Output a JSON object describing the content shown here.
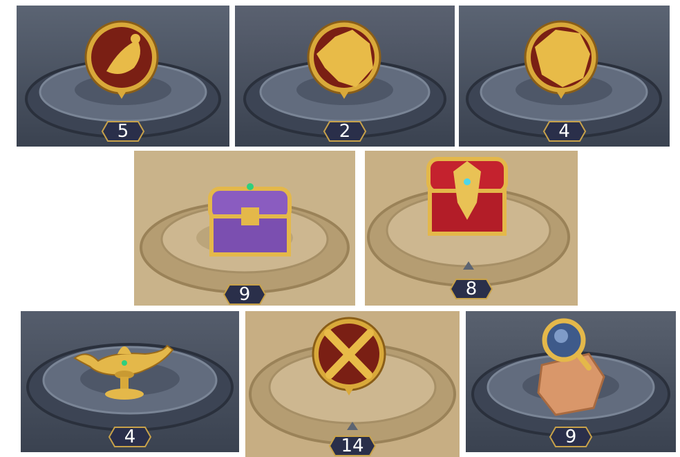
{
  "tiles": [
    {
      "row": 1,
      "kind": "stone",
      "icon": "scorcerer-scorpion-medallion",
      "icon_name": "scorpion-icon",
      "count": "5"
    },
    {
      "row": 1,
      "kind": "stone",
      "icon": "wolf-medallion",
      "icon_name": "wolf-icon",
      "count": "2"
    },
    {
      "row": 1,
      "kind": "stone",
      "icon": "lion-medallion",
      "icon_name": "lion-icon",
      "count": "4"
    },
    {
      "row": 2,
      "kind": "sand",
      "icon": "purple-treasure-chest",
      "icon_name": "purple-chest-icon",
      "count": "9"
    },
    {
      "row": 2,
      "kind": "sand",
      "icon": "red-treasure-chest",
      "icon_name": "red-chest-icon",
      "count": "8"
    },
    {
      "row": 3,
      "kind": "stone",
      "icon": "magic-lamp",
      "icon_name": "magic-lamp-icon",
      "count": "4"
    },
    {
      "row": 3,
      "kind": "sand",
      "icon": "crossed-swords-medallion",
      "icon_name": "crossed-swords-icon",
      "count": "14"
    },
    {
      "row": 3,
      "kind": "stone",
      "icon": "magnifier-map",
      "icon_name": "magnifier-map-icon",
      "count": "9"
    }
  ],
  "colors": {
    "stone_bg": "#4a5363",
    "sand_bg": "#c9b38a",
    "gold": "#d9a93a",
    "medallion_red": "#7a1f14",
    "badge_fill": "#2a2f4a"
  }
}
